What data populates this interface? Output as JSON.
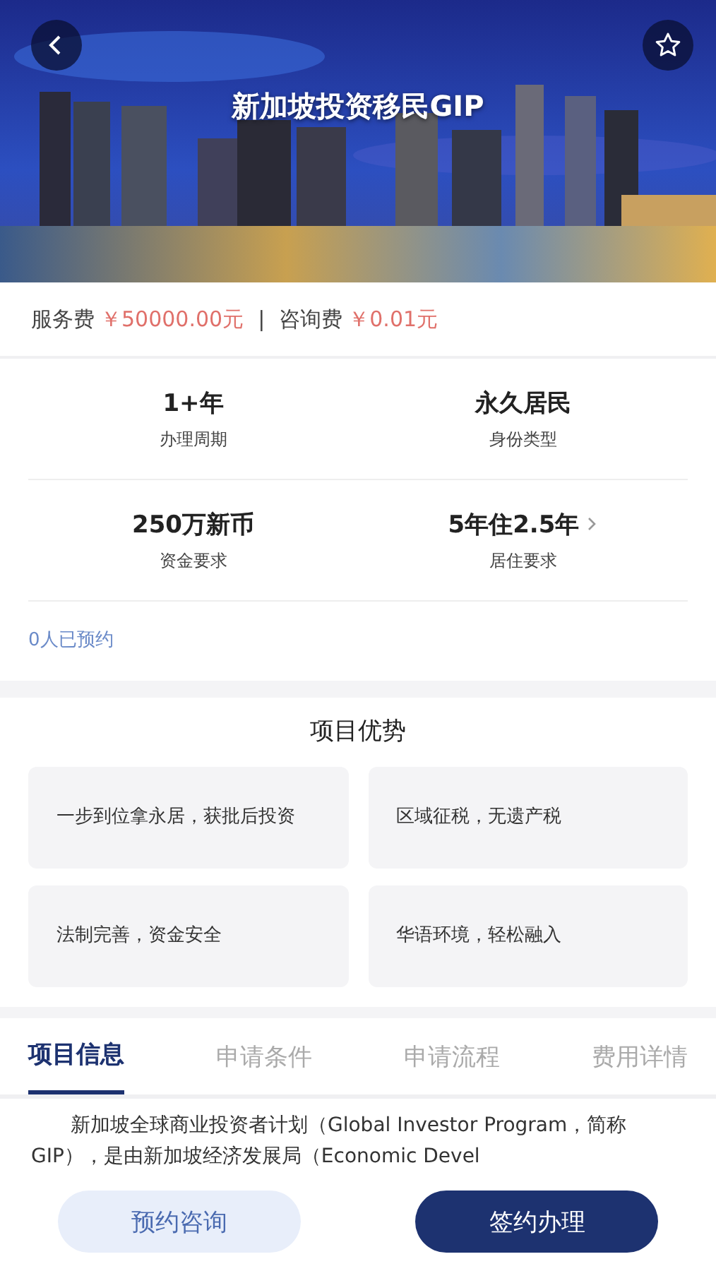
{
  "header": {
    "title": "新加坡投资移民GIP"
  },
  "fees": [
    {
      "label": "服务费",
      "amount": "￥50000.00元"
    },
    {
      "label": "咨询费",
      "amount": "￥0.01元"
    }
  ],
  "fee_separator": "|",
  "stats": [
    {
      "value": "1+年",
      "label": "办理周期",
      "has_arrow": false
    },
    {
      "value": "永久居民",
      "label": "身份类型",
      "has_arrow": false
    },
    {
      "value": "250万新币",
      "label": "资金要求",
      "has_arrow": false
    },
    {
      "value": "5年住2.5年",
      "label": "居住要求",
      "has_arrow": true
    }
  ],
  "booked_count": "0人已预约",
  "advantages": {
    "title": "项目优势",
    "items": [
      "一步到位拿永居，获批后投资",
      "区域征税，无遗产税",
      "法制完善，资金安全",
      "华语环境，轻松融入"
    ]
  },
  "tabs": [
    {
      "label": "项目信息",
      "selected": true
    },
    {
      "label": "申请条件",
      "selected": false
    },
    {
      "label": "申请流程",
      "selected": false
    },
    {
      "label": "费用详情",
      "selected": false
    }
  ],
  "intro": "新加坡全球商业投资者计划（Global Investor Program，简称GIP），是由新加坡经济发展局（Economic Devel",
  "buttons": [
    {
      "label": "预约咨询",
      "kind": "secondary"
    },
    {
      "label": "签约办理",
      "kind": "primary"
    }
  ]
}
